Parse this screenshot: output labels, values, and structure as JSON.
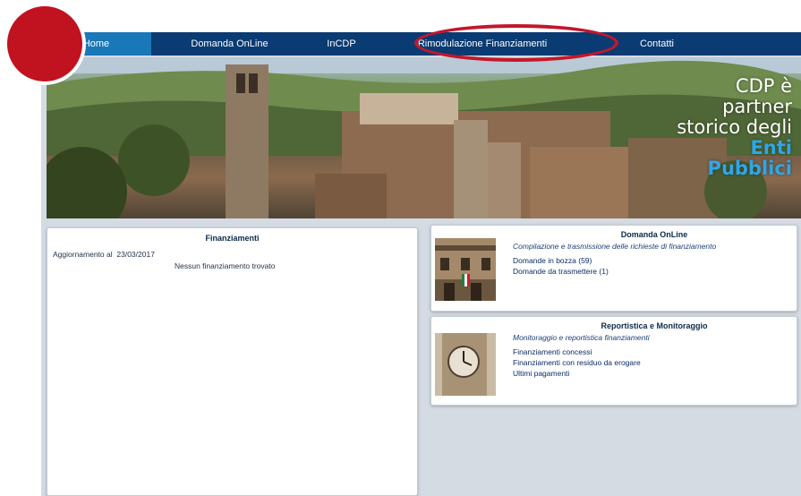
{
  "nav": {
    "items": [
      {
        "label": "Home",
        "active": true
      },
      {
        "label": "Domanda OnLine",
        "active": false
      },
      {
        "label": "InCDP",
        "active": false
      },
      {
        "label": "Rimodulazione Finanziamenti",
        "active": false
      },
      {
        "label": "Contatti",
        "active": false
      }
    ]
  },
  "hero": {
    "line1": "CDP è",
    "line2": "partner",
    "line3": "storico degli",
    "line4": "Enti",
    "line5": "Pubblici"
  },
  "finanziamenti": {
    "title": "Finanziamenti",
    "update_label": "Aggiornamento al",
    "update_date": "23/03/2017",
    "empty_message": "Nessun finanziamento trovato"
  },
  "domanda": {
    "title": "Domanda OnLine",
    "subtitle": "Compilazione e trasmissione delle richieste di finanziamento",
    "links": [
      "Domande in bozza (59)",
      "Domande da trasmettere (1)"
    ]
  },
  "reportistica": {
    "title": "Reportistica e Monitoraggio",
    "subtitle": "Monitoraggio e reportistica finanziamenti",
    "links": [
      "Finanziamenti concessi",
      "Finanziamenti con residuo da erogare",
      "Ultimi pagamenti"
    ]
  },
  "colors": {
    "nav_bg": "#0a3b72",
    "nav_active": "#1a77b8",
    "highlight": "#c2182b",
    "accent_text": "#2fa6e8"
  }
}
